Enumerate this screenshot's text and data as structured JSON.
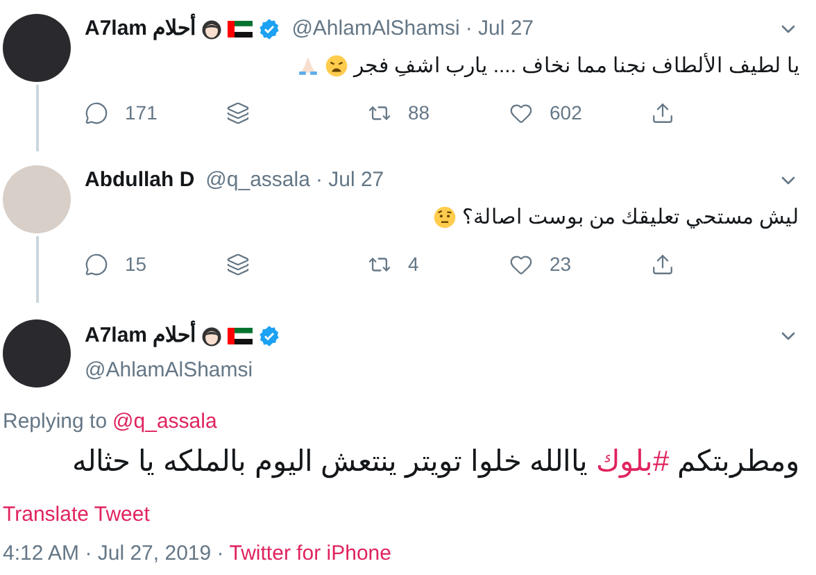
{
  "thread": [
    {
      "name": "A7lam أحلام",
      "verified": true,
      "handle": "@AhlamAlShamsi",
      "time": "· Jul 27",
      "text": "يا لطيف الألطاف نجنا مما نخاف .... يارب اشفِ فجر",
      "stats": {
        "replies": "171",
        "retweets": "88",
        "likes": "602"
      }
    },
    {
      "name": "Abdullah D",
      "verified": false,
      "handle": "@q_assala",
      "time": "· Jul 27",
      "text": "ليش مستحي تعليقك من بوست اصالة؟",
      "stats": {
        "replies": "15",
        "retweets": "4",
        "likes": "23"
      }
    }
  ],
  "main_tweet": {
    "name": "A7lam أحلام",
    "verified": true,
    "handle": "@AhlamAlShamsi",
    "replying_label": "Replying to",
    "replying_to": "@q_assala",
    "text_parts": [
      {
        "kind": "text",
        "text": "ومطربتكم "
      },
      {
        "kind": "hashtag",
        "text": "#بلوك"
      },
      {
        "kind": "text",
        "text": " ياالله خلوا تويتر ينتعش اليوم بالملكه يا حثاله"
      }
    ],
    "translate": "Translate Tweet",
    "timestamp": "4:12 AM · Jul 27, 2019 ·",
    "source": "Twitter for iPhone"
  }
}
